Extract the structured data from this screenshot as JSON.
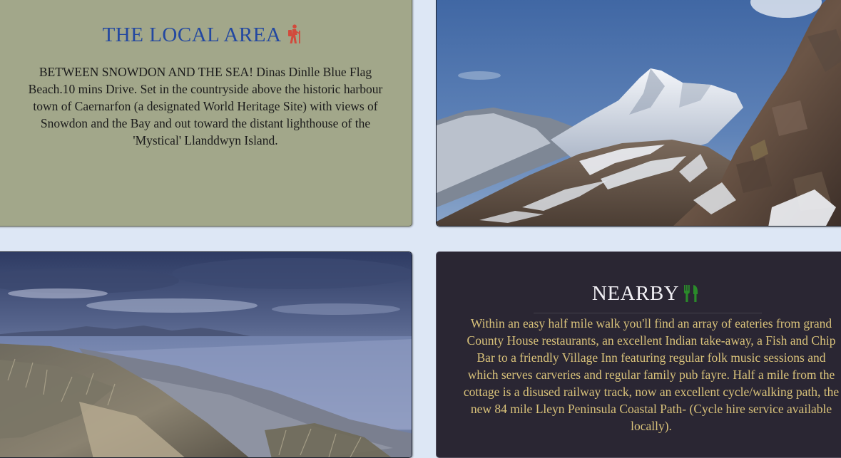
{
  "local_area": {
    "title": "THE LOCAL AREA",
    "icon": "hiker-icon",
    "icon_color": "#d24a3c",
    "text": "BETWEEN SNOWDON AND THE SEA! Dinas Dinlle Blue Flag Beach.10 mins Drive. Set in the countryside above the historic harbour town of Caernarfon (a designated World Heritage Site) with views of Snowdon and the Bay and out toward the distant lighthouse of the 'Mystical' Llanddwyn Island."
  },
  "nearby": {
    "title": "NEARBY",
    "icon": "utensils-icon",
    "icon_color": "#2a8a2a",
    "text": "Within an easy half mile walk you'll find an array of eateries from grand County House restaurants, an excellent Indian take-away, a Fish and Chip Bar to a friendly Village Inn featuring regular folk music sessions and which serves carveries and regular family pub fayre. Half a mile from the cottage is a disused railway track, now an excellent cycle/walking path, the new 84 mile Lleyn Peninsula Coastal Path- (Cycle hire service available locally)."
  },
  "colors": {
    "page_background": "#dde7f5",
    "local_card": "#a2a78a",
    "nearby_card": "#2a2633",
    "local_title": "#2348a0",
    "nearby_text": "#d9c27a"
  }
}
